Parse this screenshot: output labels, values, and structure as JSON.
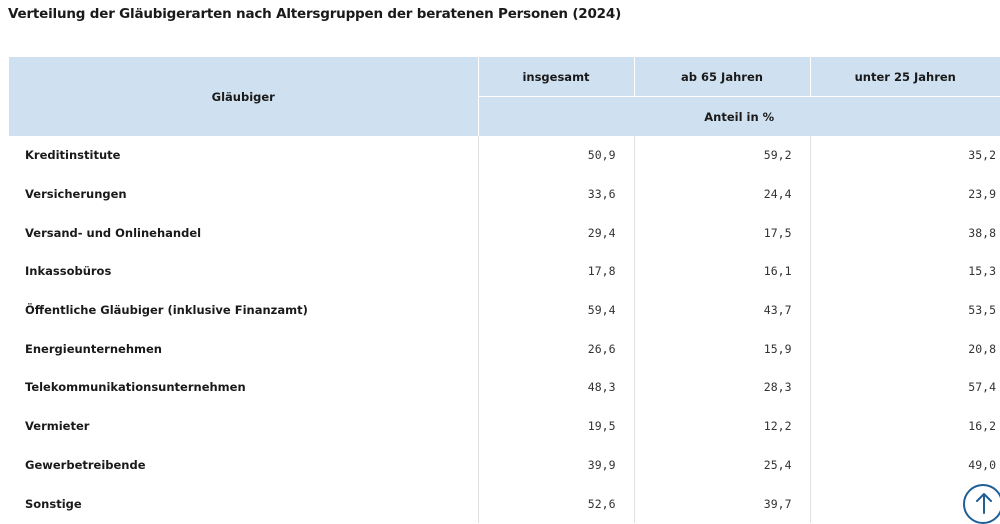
{
  "title": "Verteilung der Gläubigerarten nach Altersgruppen der beratenen Personen (2024)",
  "table": {
    "header_first": "Gläubiger",
    "columns": [
      "insgesamt",
      "ab 65 Jahren",
      "unter 25 Jahren"
    ],
    "unit_row": "Anteil in %",
    "rows": [
      {
        "label": "Kreditinstitute",
        "values": [
          "50,9",
          "59,2",
          "35,2"
        ]
      },
      {
        "label": "Versicherungen",
        "values": [
          "33,6",
          "24,4",
          "23,9"
        ]
      },
      {
        "label": "Versand- und Onlinehandel",
        "values": [
          "29,4",
          "17,5",
          "38,8"
        ]
      },
      {
        "label": "Inkassobüros",
        "values": [
          "17,8",
          "16,1",
          "15,3"
        ]
      },
      {
        "label": "Öffentliche Gläubiger (inklusive Finanzamt)",
        "values": [
          "59,4",
          "43,7",
          "53,5"
        ]
      },
      {
        "label": "Energieunternehmen",
        "values": [
          "26,6",
          "15,9",
          "20,8"
        ]
      },
      {
        "label": "Telekommunikationsunternehmen",
        "values": [
          "48,3",
          "28,3",
          "57,4"
        ]
      },
      {
        "label": "Vermieter",
        "values": [
          "19,5",
          "12,2",
          "16,2"
        ]
      },
      {
        "label": "Gewerbetreibende",
        "values": [
          "39,9",
          "25,4",
          "49,0"
        ]
      },
      {
        "label": "Sonstige",
        "values": [
          "52,6",
          "39,7",
          ""
        ]
      }
    ]
  },
  "icons": {
    "scroll_top": "arrow-up-icon",
    "accent": "#1f5f96",
    "header_bg": "#cfe0f0"
  }
}
